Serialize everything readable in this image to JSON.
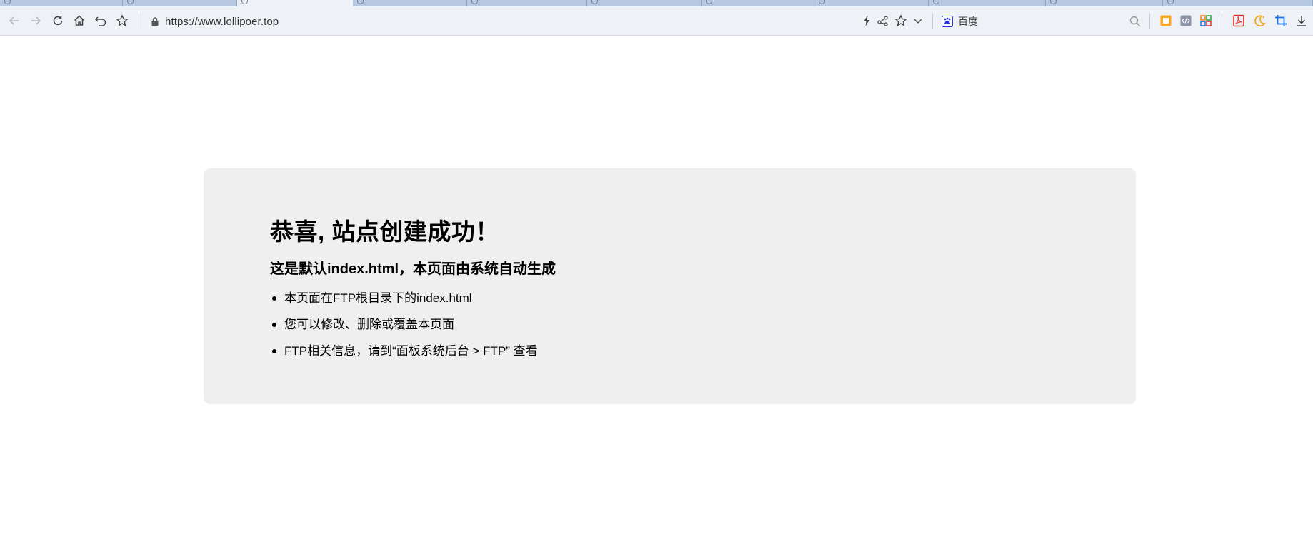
{
  "browser": {
    "address_url": "https://www.lollipoer.top",
    "search_engine_name": "百度",
    "accent_color": "#1a73e8",
    "icons": [
      "back-arrow-icon",
      "forward-arrow-icon",
      "reload-icon",
      "home-icon",
      "undo-close-tab-icon",
      "bookmark-star-icon",
      "lock-icon",
      "lightning-icon",
      "share-icon",
      "favorite-star-icon",
      "chevron-down-icon",
      "baidu-paw-icon",
      "search-icon",
      "extension-orange-icon",
      "extension-code-icon",
      "extension-grid-icon",
      "pdf-icon",
      "night-mode-icon",
      "crop-icon",
      "download-icon"
    ]
  },
  "page": {
    "title": "恭喜, 站点创建成功！",
    "subtitle": "这是默认index.html，本页面由系统自动生成",
    "items": [
      "本页面在FTP根目录下的index.html",
      "您可以修改、删除或覆盖本页面",
      "FTP相关信息，请到“面板系统后台 > FTP” 查看"
    ]
  }
}
